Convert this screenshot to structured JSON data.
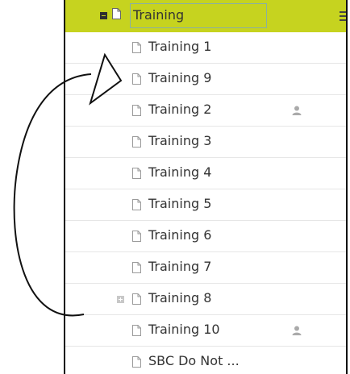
{
  "tree": {
    "root_label": "Training",
    "items": [
      {
        "label": "Training 1",
        "user": false,
        "expandable": false
      },
      {
        "label": "Training 9",
        "user": false,
        "expandable": false
      },
      {
        "label": "Training 2",
        "user": true,
        "expandable": false
      },
      {
        "label": "Training 3",
        "user": false,
        "expandable": false
      },
      {
        "label": "Training 4",
        "user": false,
        "expandable": false
      },
      {
        "label": "Training 5",
        "user": false,
        "expandable": false
      },
      {
        "label": "Training 6",
        "user": false,
        "expandable": false
      },
      {
        "label": "Training 7",
        "user": false,
        "expandable": false
      },
      {
        "label": "Training 8",
        "user": false,
        "expandable": true
      },
      {
        "label": "Training 10",
        "user": true,
        "expandable": false
      },
      {
        "label": "SBC Do Not ...",
        "user": false,
        "expandable": false
      }
    ]
  },
  "colors": {
    "root_bg": "#c6d31f",
    "text": "#333333",
    "icon": "#9a9a9a"
  },
  "icons": {
    "page": "page-icon",
    "user": "user-icon",
    "collapse": "collapse-icon",
    "expand": "expand-icon",
    "menu": "menu-icon"
  }
}
